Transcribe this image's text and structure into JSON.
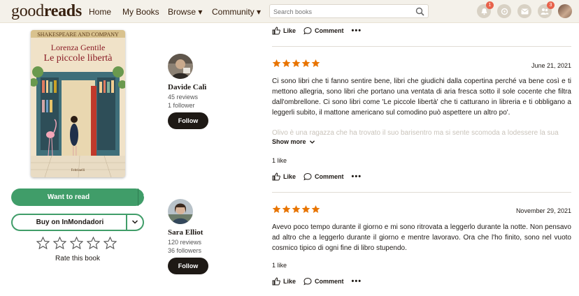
{
  "header": {
    "logo_light": "good",
    "logo_bold": "reads",
    "nav": [
      "Home",
      "My Books",
      "Browse ▾",
      "Community ▾"
    ],
    "search_placeholder": "Search books",
    "badges": {
      "notifications": "1",
      "friends": "3"
    },
    "icons": [
      "bell-icon",
      "discussions-icon",
      "messages-icon",
      "friends-icon"
    ]
  },
  "book": {
    "cover_publisher": "SHAKESPEARE AND COMPANY",
    "cover_author": "Lorenza Gentile",
    "cover_title": "Le piccole libertà",
    "cover_imprint": "Feltrinelli",
    "want_to_read": "Want to read",
    "buy_label": "Buy on InMondadori",
    "rate_label": "Rate this book",
    "rating_stars": 5
  },
  "top_actions": {
    "like": "Like",
    "comment": "Comment",
    "more": "•••"
  },
  "reviews": [
    {
      "name": "Davide Calì",
      "reviews_count": "45 reviews",
      "followers": "1 follower",
      "follow": "Follow",
      "stars": 5,
      "date": "June 21, 2021",
      "text": "Ci sono libri che ti fanno sentire bene, libri che giudichi dalla copertina perché va bene così e ti mettono allegria, sono libri che portano una ventata di aria fresca sotto il sole cocente che filtra dall'ombrellone. Ci sono libri come 'Le piccole libertà' che ti catturano in libreria e ti obbligano a leggerli subito, il mattone americano sul comodino può aspettere un altro po'.",
      "faded_text": "Olivo è una ragazza che ha trovato il suo barisentro ma si sente scomoda a lodessere la sua",
      "show_more": "Show more",
      "likes": "1 like",
      "like": "Like",
      "comment": "Comment",
      "more": "•••"
    },
    {
      "name": "Sara Elliot",
      "reviews_count": "120 reviews",
      "followers": "36 followers",
      "follow": "Follow",
      "stars": 5,
      "date": "November 29, 2021",
      "text": "Avevo poco tempo durante il giorno e mi sono ritrovata a leggerlo durante la notte. Non pensavo ad altro che a leggerlo durante il giorno e mentre lavoravo. Ora che l'ho finito, sono nel vuoto cosmico tipico di ogni fine di libro stupendo.",
      "likes": "1 like",
      "like": "Like",
      "comment": "Comment",
      "more": "•••"
    }
  ],
  "colors": {
    "green": "#409d69",
    "star": "#e87400",
    "header_bg": "#f4f1ea",
    "brown": "#382110"
  }
}
